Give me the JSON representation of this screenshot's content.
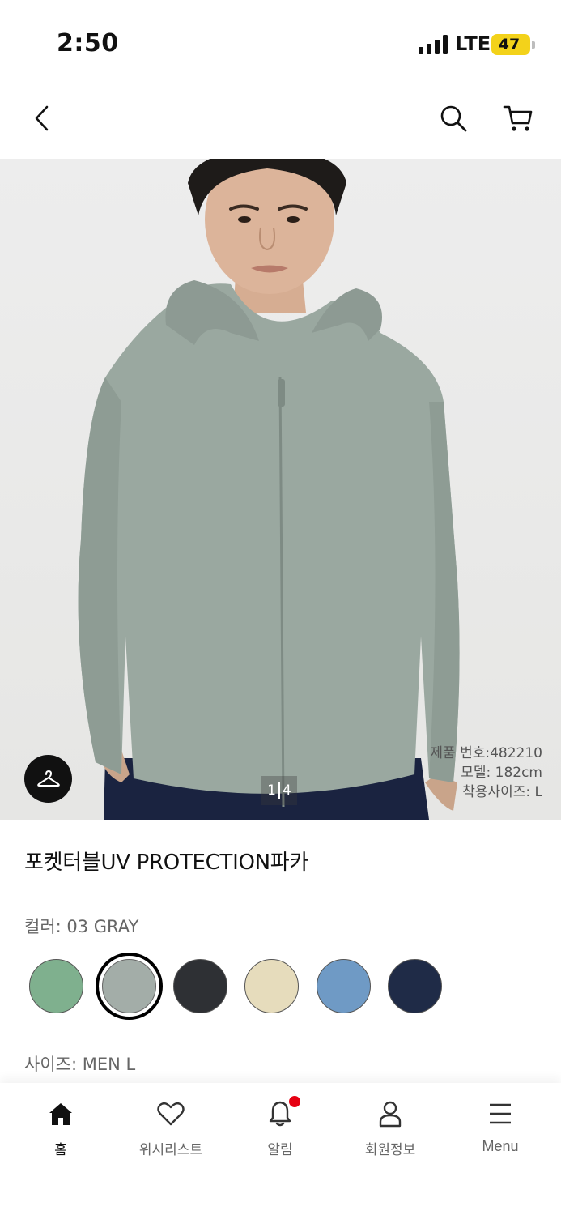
{
  "status_bar": {
    "time": "2:50",
    "network": "LTE",
    "battery": "47"
  },
  "header": {
    "back_icon": "chevron-left-icon",
    "search_icon": "search-icon",
    "cart_icon": "cart-icon"
  },
  "hero": {
    "model_info": [
      "제품 번호:482210",
      "모델: 182cm",
      "착용사이즈: L"
    ],
    "page_current": "1",
    "page_total": "4",
    "fitting_icon": "hanger-icon"
  },
  "product": {
    "title": "포켓터블UV PROTECTION파카",
    "color_label": "컬러: 03 GRAY",
    "size_label": "사이즈: MEN L",
    "colors": [
      {
        "hex": "#7fb08e",
        "selected": false
      },
      {
        "hex": "#a3ada8",
        "selected": true
      },
      {
        "hex": "#2e3034",
        "selected": false
      },
      {
        "hex": "#e6dcbc",
        "selected": false
      },
      {
        "hex": "#6f9ac5",
        "selected": false
      },
      {
        "hex": "#1f2b47",
        "selected": false
      }
    ]
  },
  "bottom_nav": {
    "items": [
      {
        "label": "홈",
        "icon": "home-icon",
        "active": true
      },
      {
        "label": "위시리스트",
        "icon": "heart-icon",
        "active": false
      },
      {
        "label": "알림",
        "icon": "bell-icon",
        "active": false
      },
      {
        "label": "회원정보",
        "icon": "user-icon",
        "active": false
      },
      {
        "label": "Menu",
        "icon": "menu-icon",
        "active": false
      }
    ],
    "alert_color": "#e60012"
  }
}
